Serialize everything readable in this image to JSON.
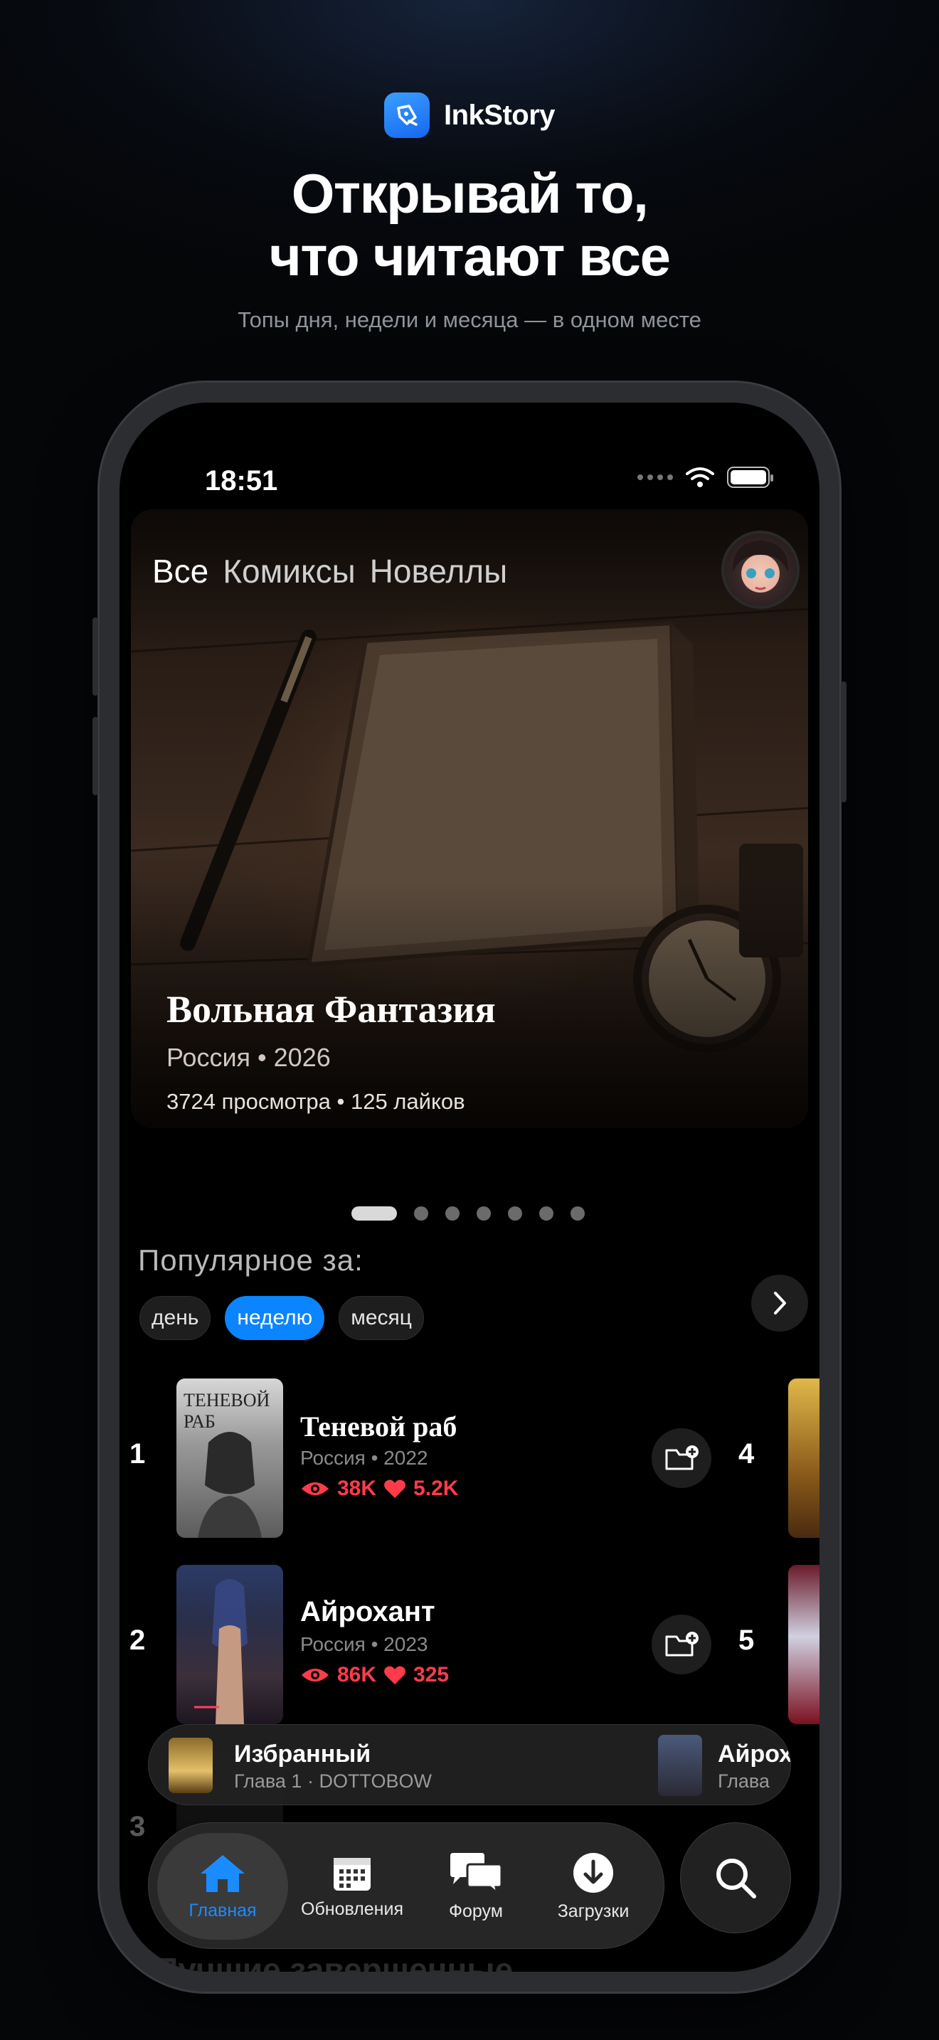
{
  "brand": {
    "name": "InkStory"
  },
  "headline": {
    "line1": "Открывай то,",
    "line2": "что читают все"
  },
  "subline": "Топы дня, недели и месяца — в одном месте",
  "status_bar": {
    "time": "18:51"
  },
  "hero": {
    "tabs": [
      "Все",
      "Комиксы",
      "Новеллы"
    ],
    "title": "Вольная Фантазия",
    "meta": "Россия • 2026",
    "stats": "3724 просмотра  •  125 лайков",
    "pages_total": 7,
    "page_active": 1
  },
  "popular": {
    "title": "Популярное за:",
    "periods": [
      "день",
      "неделю",
      "месяц"
    ],
    "selected_period": "неделю"
  },
  "ranking": [
    {
      "rank": "1",
      "title": "Теневой раб",
      "cover_text": "ТЕНЕВОЙ РАБ",
      "meta": "Россия • 2022",
      "views": "38K",
      "likes": "5.2K",
      "side_rank": "4"
    },
    {
      "rank": "2",
      "title": "Айрохант",
      "meta": "Россия • 2023",
      "views": "86K",
      "likes": "325",
      "side_rank": "5"
    },
    {
      "rank": "3"
    }
  ],
  "continue": [
    {
      "title": "Избранный",
      "subtitle": "Глава 1 · DOTTOBOW"
    },
    {
      "title": "Айрохант",
      "subtitle": "Глава"
    }
  ],
  "tabbar": {
    "items": [
      {
        "label": "Главная",
        "icon": "home-icon"
      },
      {
        "label": "Обновления",
        "icon": "calendar-icon"
      },
      {
        "label": "Форум",
        "icon": "chat-bubbles-icon"
      },
      {
        "label": "Загрузки",
        "icon": "download-icon"
      }
    ],
    "active": "Главная"
  },
  "bottom_peek_title": "Лучшие завершенные",
  "colors": {
    "accent": "#0a84ff",
    "stats": "#ff3b4a",
    "background": "#000000"
  }
}
